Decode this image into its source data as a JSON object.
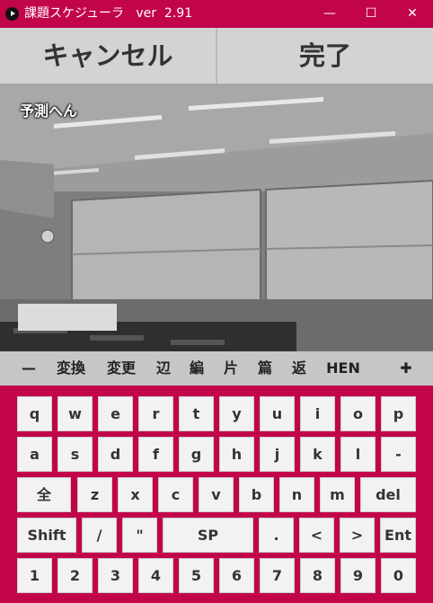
{
  "window": {
    "title": "課題スケジューラ   ver  2.91",
    "minimize_glyph": "—",
    "maximize_glyph": "☐",
    "close_glyph": "✕"
  },
  "actions": {
    "cancel": "キャンセル",
    "done": "完了"
  },
  "input": {
    "text": "予測へん"
  },
  "conversion": {
    "minus": "—",
    "items": [
      "変換",
      "変更",
      "辺",
      "編",
      "片",
      "篇",
      "返",
      "HEN"
    ],
    "plus": "✚"
  },
  "keyboard": {
    "row1": [
      "q",
      "w",
      "e",
      "r",
      "t",
      "y",
      "u",
      "i",
      "o",
      "p"
    ],
    "row2": [
      "a",
      "s",
      "d",
      "f",
      "g",
      "h",
      "j",
      "k",
      "l",
      "-"
    ],
    "row3": [
      "全",
      "z",
      "x",
      "c",
      "v",
      "b",
      "n",
      "m",
      "del"
    ],
    "row4": [
      "Shift",
      "/",
      "\"",
      "SP",
      ".",
      "<",
      ">",
      "Ent"
    ],
    "row5": [
      "1",
      "2",
      "3",
      "4",
      "5",
      "6",
      "7",
      "8",
      "9",
      "0"
    ]
  },
  "colors": {
    "accent": "#c2054a",
    "key": "#f2f2f2",
    "bar": "#d3d3d3"
  }
}
